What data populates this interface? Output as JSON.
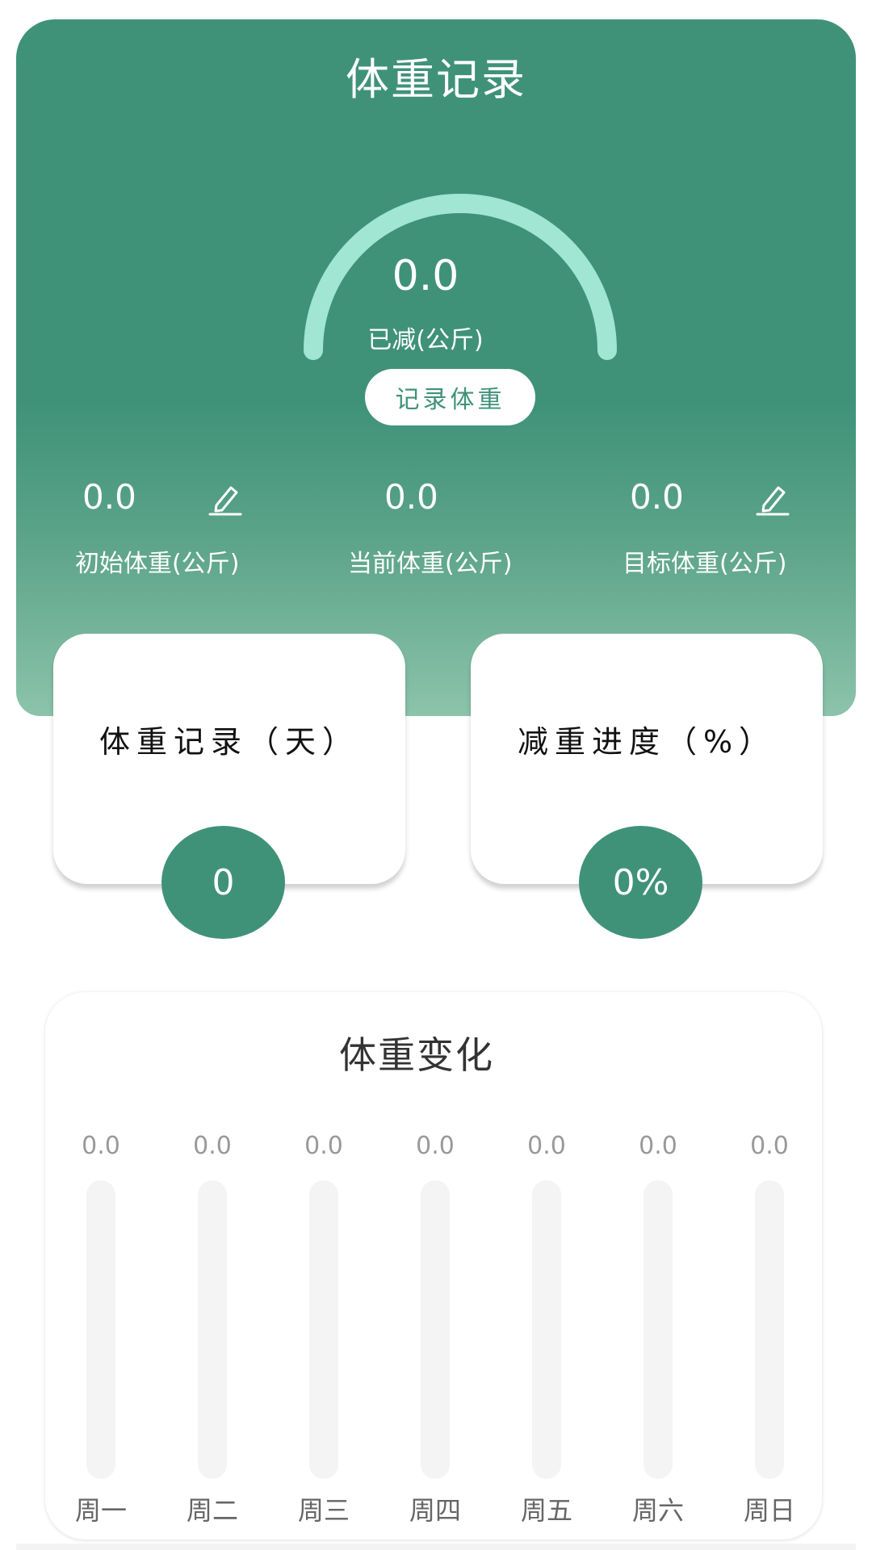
{
  "header": {
    "title": "体重记录",
    "gauge": {
      "value": "0.0",
      "label": "已减(公斤)",
      "progress": 0
    },
    "record_button": "记录体重",
    "stats": [
      {
        "value": "0.0",
        "label": "初始体重(公斤)",
        "editable": true
      },
      {
        "value": "0.0",
        "label": "当前体重(公斤)",
        "editable": false
      },
      {
        "value": "0.0",
        "label": "目标体重(公斤)",
        "editable": true
      }
    ]
  },
  "cards": [
    {
      "title": "体重记录（天）",
      "value": "0"
    },
    {
      "title": "减重进度（%）",
      "value": "0%"
    }
  ],
  "colors": {
    "primary": "#3f9278",
    "gauge_arc": "#a0e6d2",
    "track": "#f4f4f4"
  },
  "chart_data": {
    "type": "bar",
    "title": "体重变化",
    "categories": [
      "周一",
      "周二",
      "周三",
      "周四",
      "周五",
      "周六",
      "周日"
    ],
    "values": [
      0.0,
      0.0,
      0.0,
      0.0,
      0.0,
      0.0,
      0.0
    ],
    "value_labels": [
      "0.0",
      "0.0",
      "0.0",
      "0.0",
      "0.0",
      "0.0",
      "0.0"
    ],
    "xlabel": "",
    "ylabel": "",
    "ylim": [
      0,
      100
    ],
    "grid": false
  }
}
